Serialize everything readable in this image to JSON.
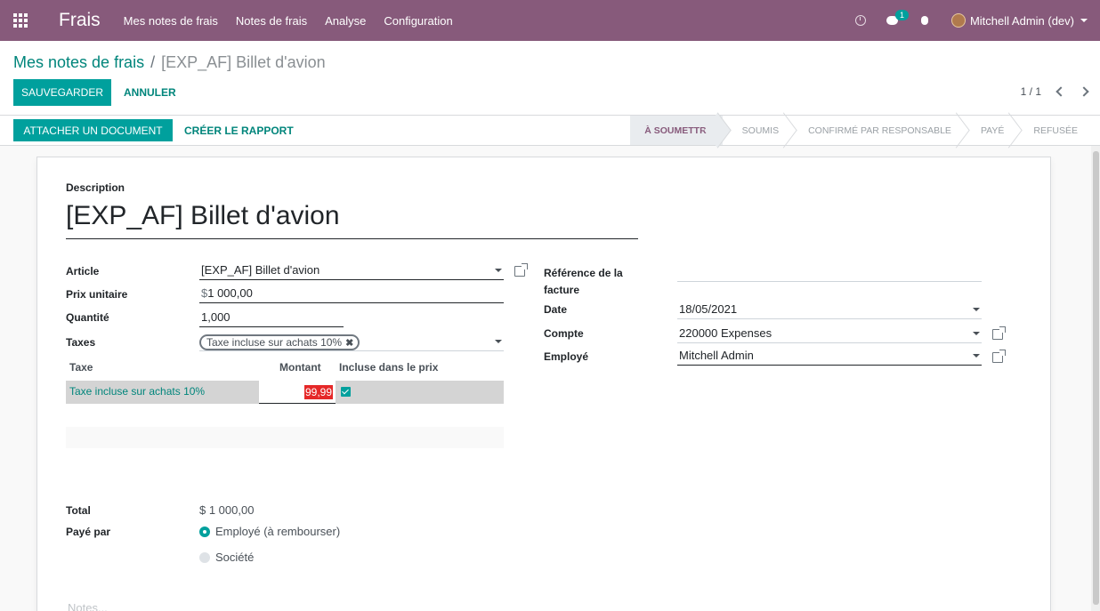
{
  "nav": {
    "brand": "Frais",
    "menu": [
      "Mes notes de frais",
      "Notes de frais",
      "Analyse",
      "Configuration"
    ],
    "chat_badge": "1",
    "user": "Mitchell Admin (dev)"
  },
  "breadcrumb": {
    "parent": "Mes notes de frais",
    "separator": "/",
    "current": "[EXP_AF] Billet d'avion"
  },
  "actions": {
    "save": "SAUVEGARDER",
    "discard": "ANNULER",
    "attach": "ATTACHER UN DOCUMENT",
    "create_report": "CRÉER LE RAPPORT"
  },
  "pager": {
    "value": "1 / 1"
  },
  "stages": [
    "À SOUMETTRE",
    "SOUMIS",
    "CONFIRMÉ PAR RESPONSABLE",
    "PAYÉ",
    "REFUSÉE"
  ],
  "stage_current": "À SOUMETTRE",
  "form": {
    "description_label": "Description",
    "description": "[EXP_AF] Billet d'avion",
    "article_label": "Article",
    "article": "[EXP_AF] Billet d'avion",
    "unit_price_label": "Prix unitaire",
    "unit_price_currency": "$",
    "unit_price": "1 000,00",
    "quantity_label": "Quantité",
    "quantity": "1,000",
    "taxes_label": "Taxes",
    "tax_tag": "Taxe incluse sur achats 10%",
    "tax_table": {
      "headers": [
        "Taxe",
        "Montant",
        "Incluse dans le prix"
      ],
      "rows": [
        {
          "name": "Taxe incluse sur achats 10%",
          "amount": "99,99",
          "included": true
        }
      ]
    },
    "invoice_ref_label": "Référence de la facture",
    "invoice_ref": "",
    "date_label": "Date",
    "date": "18/05/2021",
    "account_label": "Compte",
    "account": "220000 Expenses",
    "employee_label": "Employé",
    "employee": "Mitchell Admin",
    "total_label": "Total",
    "total": "$ 1 000,00",
    "paid_by_label": "Payé par",
    "paid_by_options": [
      "Employé (à rembourser)",
      "Société"
    ],
    "paid_by_selected": "Employé (à rembourser)",
    "notes_placeholder": "Notes..."
  },
  "colors": {
    "brand": "#875a7b",
    "accent": "#00a09d",
    "link": "#00857b",
    "error": "#e52828"
  }
}
